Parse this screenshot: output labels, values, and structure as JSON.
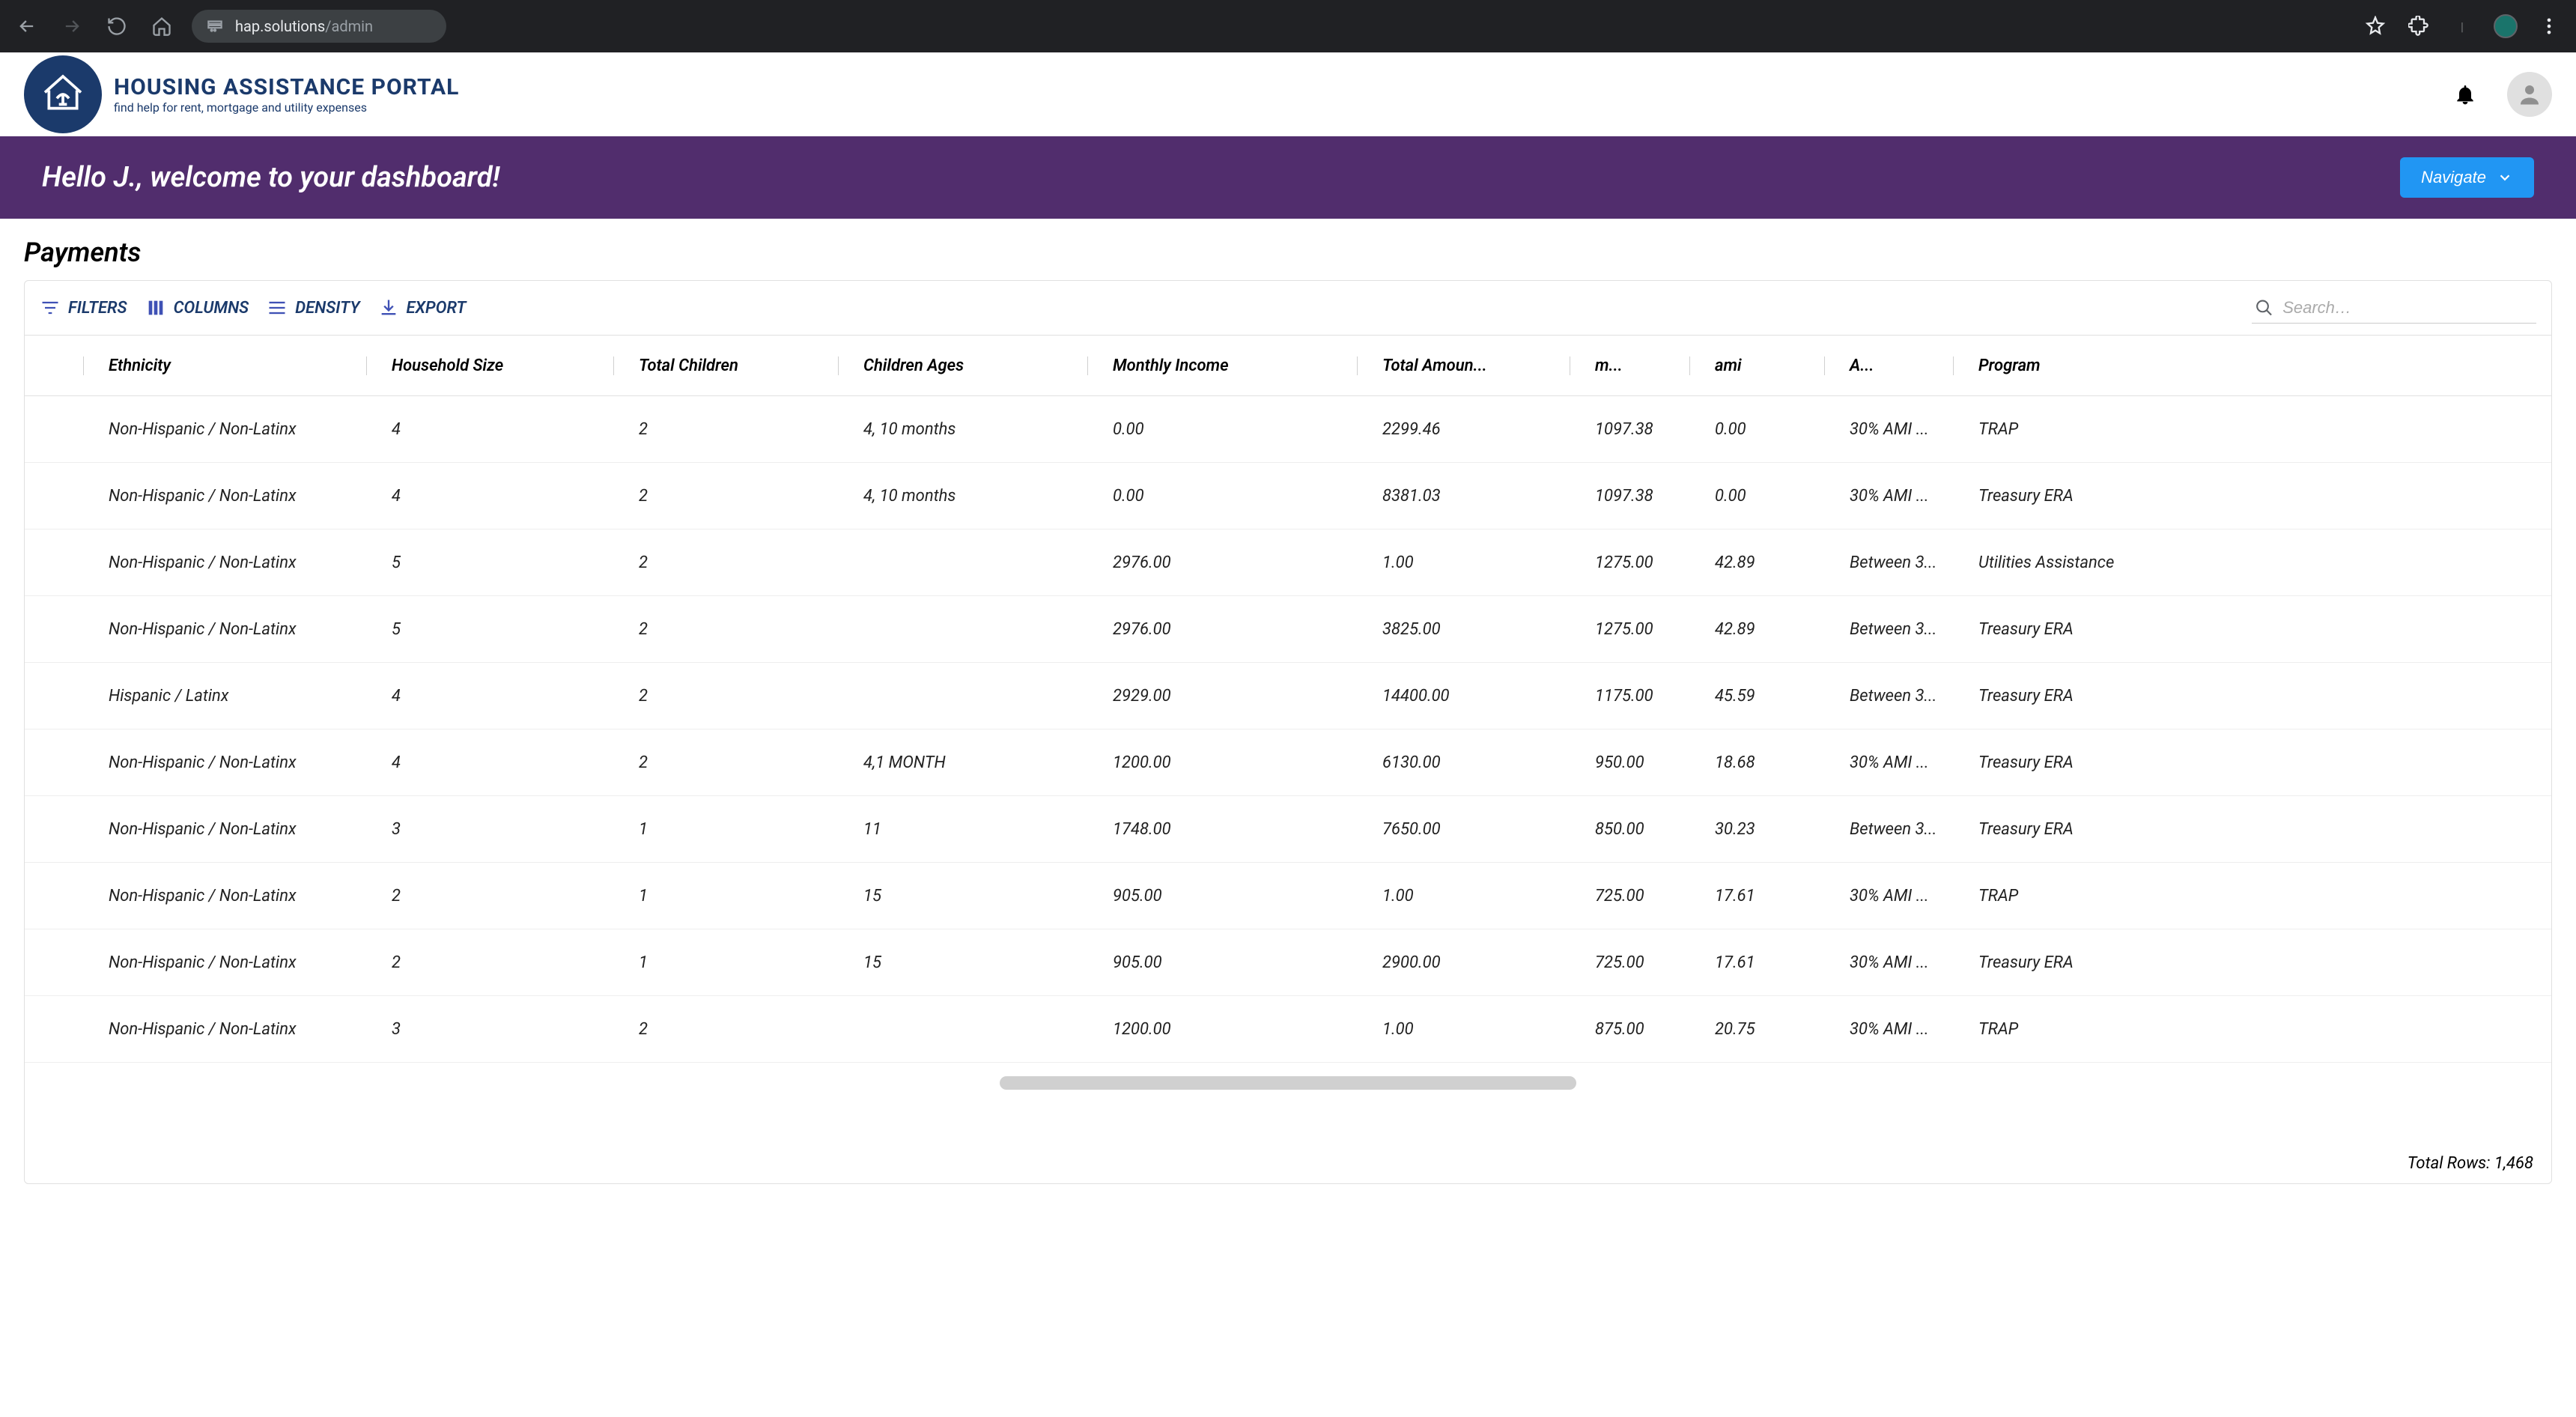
{
  "browser": {
    "url_main": "hap.solutions",
    "url_path": "/admin"
  },
  "header": {
    "logo_title": "HOUSING ASSISTANCE PORTAL",
    "logo_sub": "find help for rent, mortgage and utility expenses"
  },
  "welcome": {
    "greeting": "Hello J., welcome to your dashboard!",
    "navigate_label": "Navigate"
  },
  "page": {
    "title": "Payments"
  },
  "toolbar": {
    "filters_label": "FILTERS",
    "columns_label": "COLUMNS",
    "density_label": "DENSITY",
    "export_label": "EXPORT",
    "search_placeholder": "Search…"
  },
  "columns": {
    "ethnicity": "Ethnicity",
    "household": "Household Size",
    "children": "Total Children",
    "ages": "Children Ages",
    "income": "Monthly Income",
    "amount": "Total Amoun...",
    "m": "m...",
    "ami": "ami",
    "a": "A...",
    "program": "Program"
  },
  "rows": [
    {
      "ethnicity": "Non-Hispanic / Non-Latinx",
      "household": "4",
      "children": "2",
      "ages": "4, 10 months",
      "income": "0.00",
      "amount": "2299.46",
      "m": "1097.38",
      "ami": "0.00",
      "a": "30% AMI ...",
      "program": "TRAP"
    },
    {
      "ethnicity": "Non-Hispanic / Non-Latinx",
      "household": "4",
      "children": "2",
      "ages": "4, 10 months",
      "income": "0.00",
      "amount": "8381.03",
      "m": "1097.38",
      "ami": "0.00",
      "a": "30% AMI ...",
      "program": "Treasury ERA"
    },
    {
      "ethnicity": "Non-Hispanic / Non-Latinx",
      "household": "5",
      "children": "2",
      "ages": "",
      "income": "2976.00",
      "amount": "1.00",
      "m": "1275.00",
      "ami": "42.89",
      "a": "Between 3...",
      "program": "Utilities Assistance"
    },
    {
      "ethnicity": "Non-Hispanic / Non-Latinx",
      "household": "5",
      "children": "2",
      "ages": "",
      "income": "2976.00",
      "amount": "3825.00",
      "m": "1275.00",
      "ami": "42.89",
      "a": "Between 3...",
      "program": "Treasury ERA"
    },
    {
      "ethnicity": "Hispanic / Latinx",
      "household": "4",
      "children": "2",
      "ages": "",
      "income": "2929.00",
      "amount": "14400.00",
      "m": "1175.00",
      "ami": "45.59",
      "a": "Between 3...",
      "program": "Treasury ERA"
    },
    {
      "ethnicity": "Non-Hispanic / Non-Latinx",
      "household": "4",
      "children": "2",
      "ages": "4,1 MONTH",
      "income": "1200.00",
      "amount": "6130.00",
      "m": "950.00",
      "ami": "18.68",
      "a": "30% AMI ...",
      "program": "Treasury ERA"
    },
    {
      "ethnicity": "Non-Hispanic / Non-Latinx",
      "household": "3",
      "children": "1",
      "ages": "11",
      "income": "1748.00",
      "amount": "7650.00",
      "m": "850.00",
      "ami": "30.23",
      "a": "Between 3...",
      "program": "Treasury ERA"
    },
    {
      "ethnicity": "Non-Hispanic / Non-Latinx",
      "household": "2",
      "children": "1",
      "ages": "15",
      "income": "905.00",
      "amount": "1.00",
      "m": "725.00",
      "ami": "17.61",
      "a": "30% AMI ...",
      "program": "TRAP"
    },
    {
      "ethnicity": "Non-Hispanic / Non-Latinx",
      "household": "2",
      "children": "1",
      "ages": "15",
      "income": "905.00",
      "amount": "2900.00",
      "m": "725.00",
      "ami": "17.61",
      "a": "30% AMI ...",
      "program": "Treasury ERA"
    },
    {
      "ethnicity": "Non-Hispanic / Non-Latinx",
      "household": "3",
      "children": "2",
      "ages": "",
      "income": "1200.00",
      "amount": "1.00",
      "m": "875.00",
      "ami": "20.75",
      "a": "30% AMI ...",
      "program": "TRAP"
    }
  ],
  "footer": {
    "total_rows": "Total Rows: 1,468"
  }
}
